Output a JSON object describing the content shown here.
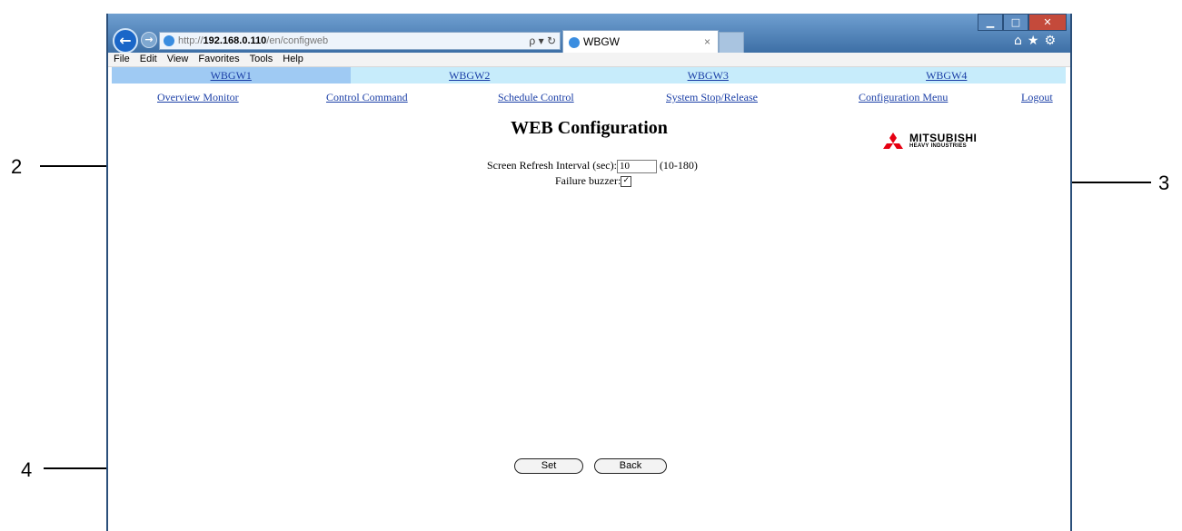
{
  "callouts": {
    "c2": "2",
    "c3": "3",
    "c4": "4"
  },
  "browser": {
    "address": {
      "protocol": "http://",
      "host": "192.168.0.110",
      "path": "/en/configweb",
      "controls": "ρ ▾ ↻"
    },
    "tab_title": "WBGW",
    "menu": [
      "File",
      "Edit",
      "View",
      "Favorites",
      "Tools",
      "Help"
    ]
  },
  "gateway_tabs": [
    "WBGW1",
    "WBGW2",
    "WBGW3",
    "WBGW4"
  ],
  "nav_links": [
    "Overview Monitor",
    "Control Command",
    "Schedule Control",
    "System Stop/Release",
    "Configuration Menu",
    "Logout"
  ],
  "page_title": "WEB Configuration",
  "logo": {
    "line1": "MITSUBISHI",
    "line2": "HEAVY INDUSTRIES"
  },
  "settings": {
    "refresh_label": "Screen Refresh Interval (sec):",
    "refresh_value": "10",
    "refresh_range": "(10-180)",
    "buzzer_label": "Failure buzzer:",
    "buzzer_checked": true
  },
  "buttons": {
    "set": "Set",
    "back": "Back"
  },
  "colors": {
    "active_tab": "#9fcaf3",
    "tab_bg": "#c7ecfb",
    "link": "#1a3ea6",
    "logo_red": "#e60012"
  }
}
